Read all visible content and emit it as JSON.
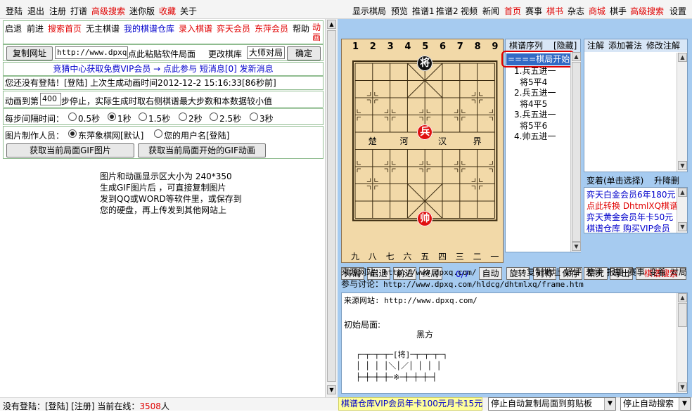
{
  "topbar": {
    "left": [
      "登陆",
      "退出",
      "注册",
      "打谱",
      "高级搜索",
      "迷你版",
      "收藏",
      "关于"
    ],
    "right": [
      "显示棋局",
      "预览",
      "推谱1",
      "推谱2",
      "视频",
      "新闻",
      "首页",
      "赛事",
      "棋书",
      "杂志",
      "商城",
      "棋手",
      "高级搜索",
      "设置"
    ]
  },
  "left": {
    "nav": [
      "启退",
      "前进",
      "搜索首页",
      "无主棋谱",
      "我的棋谱仓库",
      "录入棋谱",
      "弈天会员",
      "东萍会员",
      "帮助",
      "动画"
    ],
    "copy_url_btn": "复制网址",
    "url_value": "http://www.dpxq.",
    "paste_hint": "点此粘贴软件局面",
    "change_lib": "更改棋库",
    "lib_value": "大师对局",
    "confirm_btn": "确定",
    "promo": "竞猜中心获取免费VIP会员 → 点此参与 短消息[0] 发新消息",
    "login_info": "您还没有登陆！[登陆] 上次生成动画时间2012-12-2 15:16:33[86秒前]",
    "anim_prefix": "动画到第",
    "anim_steps": "400",
    "anim_suffix": "步停止，实际生成时取右侧棋谱最大步数和本数据较小值",
    "interval_label": "每步间隔时间：",
    "intervals": [
      "0.5秒",
      "1秒",
      "1.5秒",
      "2秒",
      "2.5秒",
      "3秒"
    ],
    "maker_label": "图片制作人员：",
    "maker_opt1": "东萍象棋网[默认]",
    "maker_opt2": "您的用户名[登陆]",
    "gif_btn1": "获取当前局面GIF图片",
    "gif_btn2": "获取当前局面开始的GIF动画",
    "info_lines": [
      "图片和动画显示区大小为 240*350",
      "生成GIF图片后 ，可直接复制图片",
      "发到QQ或WORD等软件里，或保存到",
      "您的硬盘，再上传发到其他网站上"
    ]
  },
  "board": {
    "top_numbers": [
      "1",
      "2",
      "3",
      "4",
      "5",
      "6",
      "7",
      "8",
      "9"
    ],
    "bottom_numbers": [
      "九",
      "八",
      "七",
      "六",
      "五",
      "四",
      "三",
      "二",
      "一"
    ],
    "river": [
      "楚",
      "河",
      "汉",
      "界"
    ],
    "pieces": [
      {
        "label": "将",
        "color": "#111111",
        "file": 5,
        "rank": 0
      },
      {
        "label": "兵",
        "color": "#e01010",
        "file": 5,
        "rank": 4
      },
      {
        "label": "帅",
        "color": "#e01010",
        "file": 5,
        "rank": 9
      }
    ]
  },
  "moves": {
    "header": "棋谱序列",
    "hide": "[隐藏]",
    "start": "====棋局开始",
    "list": [
      "1.兵五进一",
      "将5平4",
      "2.兵五进一",
      "将4平5",
      "3.兵五进一",
      "将5平6",
      "4.帅五进一"
    ]
  },
  "notes": {
    "tabs": [
      "注解",
      "添加著法",
      "修改注解"
    ],
    "variation": "变着(单击选择)",
    "upgrade": "升降删",
    "ads": [
      {
        "text": "弈天白金会员6年180元",
        "color": "#0000cc"
      },
      {
        "text": "点此转换 DhtmlXQ棋谱",
        "color": "#e00000"
      },
      {
        "text": "弈天黄金会员年卡50元",
        "color": "#0000cc"
      },
      {
        "text": "棋谱仓库 购买VIP会员",
        "color": "#0000cc"
      }
    ]
  },
  "toolbar": {
    "buttons_left": [
      "开局",
      "启退",
      "前进",
      "终局"
    ],
    "counter": "0/7",
    "buttons_right": [
      "自动",
      "旋转",
      "对称",
      "保存",
      "研究",
      "导出"
    ],
    "search": "棋谱搜索"
  },
  "source": {
    "label": "来源网站：",
    "url": "http://www.dpxq.com/",
    "links": [
      "复制地址",
      "好评",
      "差评",
      "报错",
      "赛事",
      "变着",
      "对局"
    ],
    "discuss_label": "参与讨论：",
    "discuss_url": "http://www.dpxq.com/hldcg/dhtmlxq/frame.htm"
  },
  "textarea": {
    "line1": "来源网站: http://www.dpxq.com/",
    "line2": "初始局面:",
    "line3": "黑方",
    "line4": "┌─┬─┬─┬─[将]─┬─┬─┬─┐",
    "line5": "│ │ │ │＼│／│ │ │ │",
    "line6": "├─┼─┼─┼─※─┼─┼─┼─┤"
  },
  "status": {
    "text": "没有登陆：[登陆] [注册] 当前在线：",
    "online": "3508",
    "unit": "人",
    "vip": "棋谱仓库VIP会员年卡100元月卡15元",
    "sel1": "停止自动复制局面到剪贴板",
    "sel2": "停止自动搜索"
  },
  "colors": {
    "accent_red": "#e00000",
    "link_blue": "#0000cc",
    "board": "#f2d9a8",
    "panel": "#a6cbf0"
  }
}
